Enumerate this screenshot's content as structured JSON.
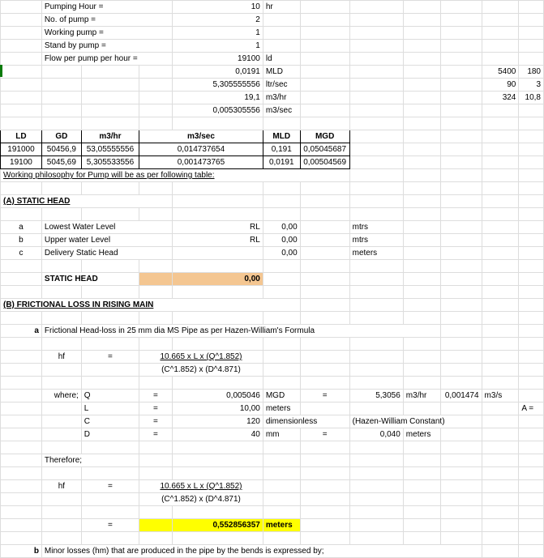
{
  "top": {
    "labels": {
      "pumping_hour": "Pumping Hour =",
      "no_of_pump": "No. of pump =",
      "working_pump": "Working pump =",
      "standby_pump": "Stand by pump =",
      "flow_per_pump": "Flow per pump per hour ="
    },
    "values": {
      "pumping_hour": "10",
      "pumping_hour_unit": "hr",
      "no_of_pump": "2",
      "working_pump": "1",
      "standby_pump": "1",
      "flow_val_ld": "19100",
      "flow_unit_ld": "ld",
      "flow_val_mld": "0,0191",
      "flow_unit_mld": "MLD",
      "flow_val_ltrsec": "5,305555556",
      "flow_unit_ltrsec": "ltr/sec",
      "flow_val_m3hr": "19,1",
      "flow_unit_m3hr": "m3/hr",
      "flow_val_m3sec": "0,005305556",
      "flow_unit_m3sec": "m3/sec"
    },
    "side": {
      "r1a": "5400",
      "r1b": "180",
      "r2a": "90",
      "r2b": "3",
      "r3a": "324",
      "r3b": "10,8"
    }
  },
  "table": {
    "headers": {
      "ld": "LD",
      "gd": "GD",
      "m3hr": "m3/hr",
      "m3sec": "m3/sec",
      "mld": "MLD",
      "mgd": "MGD"
    },
    "rows": [
      {
        "ld": "191000",
        "gd": "50456,9",
        "m3hr": "53,05555556",
        "m3sec": "0,014737654",
        "mld": "0,191",
        "mgd": "0,05045687"
      },
      {
        "ld": "19100",
        "gd": "5045,69",
        "m3hr": "5,305533556",
        "m3sec": "0,001473765",
        "mld": "0,0191",
        "mgd": "0,00504569"
      }
    ]
  },
  "philosophy": "Working philosophy for Pump will be as per following table:",
  "secA": {
    "title": "(A) STATIC HEAD",
    "rows": {
      "a_idx": "a",
      "a_lab": "Lowest Water Level",
      "a_mid": "RL",
      "a_val": "0,00",
      "a_unit": "mtrs",
      "b_idx": "b",
      "b_lab": "Upper water Level",
      "b_mid": "RL",
      "b_val": "0,00",
      "b_unit": "mtrs",
      "c_idx": "c",
      "c_lab": "Delivery Static Head",
      "c_val": "0,00",
      "c_unit": "meters"
    },
    "static_head_label": "STATIC HEAD",
    "static_head_val": "0,00"
  },
  "secB": {
    "title": "(B) FRICTIONAL LOSS IN RISING MAIN",
    "a_idx": "a",
    "a_text": "Frictional Head-loss in 25 mm dia MS Pipe as per Hazen-William's Formula",
    "hf": "hf",
    "eq": "=",
    "num": "10.665 x L x (Q^1.852)",
    "den": "(C^1.852) x (D^4.871)",
    "where": "where;",
    "Q": "Q",
    "L": "L",
    "C": "C",
    "D": "D",
    "Qv": "0,005046",
    "Qu": "MGD",
    "Qe": "=",
    "Qv2": "5,3056",
    "Qu2": "m3/hr",
    "Qv3": "0,001474",
    "Qu3": "m3/s",
    "Lv": "10,00",
    "Lu": "meters",
    "Cv": "120",
    "Cu": "dimensionless",
    "Cnote": "(Hazen-William Constant)",
    "Dv": "40",
    "Du": "mm",
    "De": "=",
    "Dv2": "0,040",
    "Du2": "meters",
    "therefore": "Therefore;",
    "result": "0,552856357",
    "result_u": "meters",
    "b_idx": "b",
    "b_text": "Minor losses (hm) that are produced in the pipe by the bends is expressed by;",
    "A_equals": "A ="
  }
}
